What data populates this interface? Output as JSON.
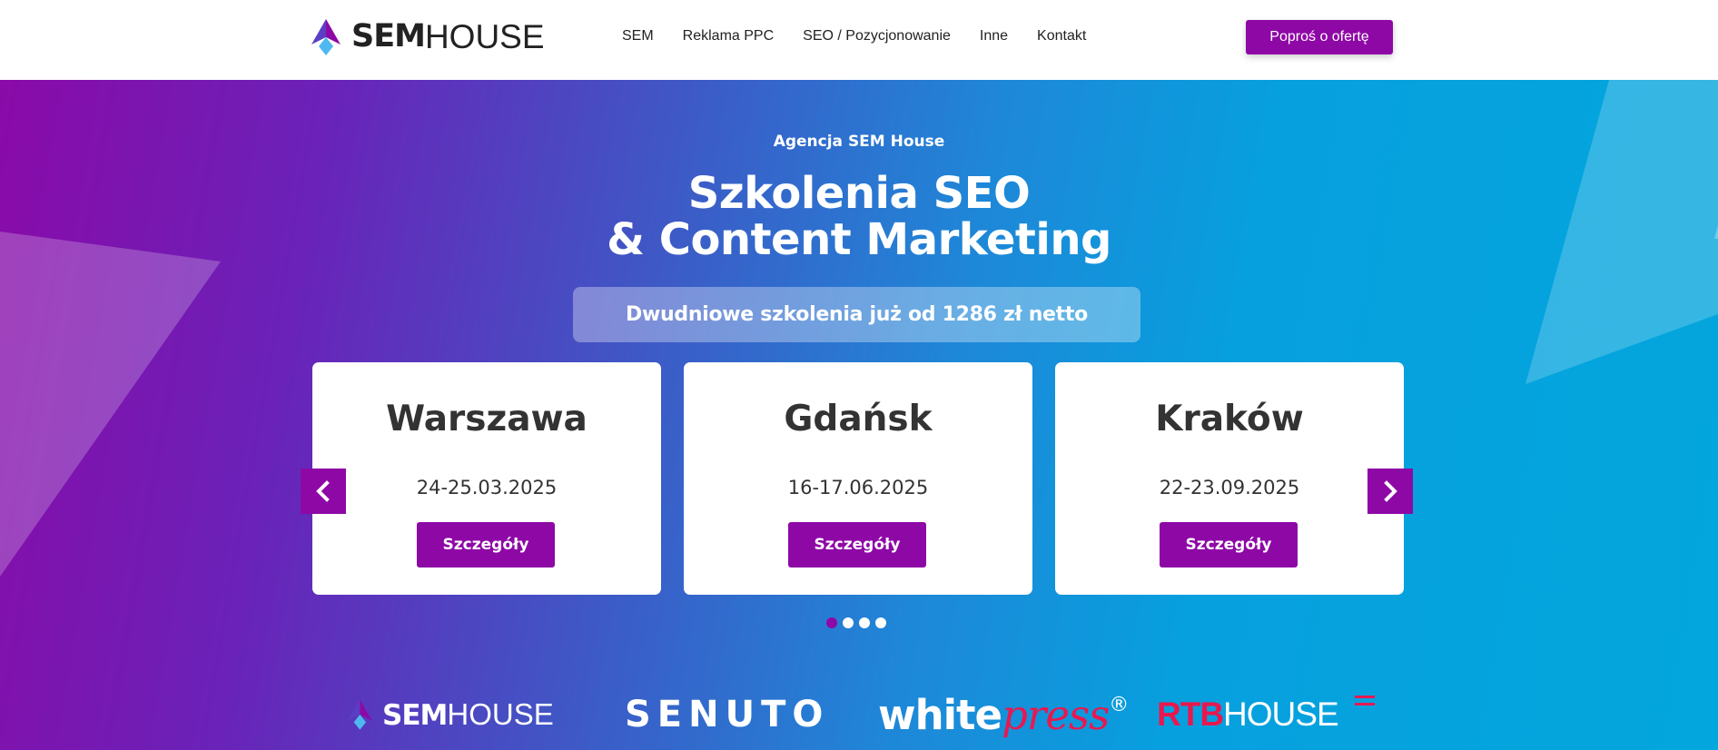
{
  "header": {
    "logo_bold": "SEM",
    "logo_light": "HOUSE",
    "nav": [
      "SEM",
      "Reklama PPC",
      "SEO / Pozycjonowanie",
      "Inne",
      "Kontakt"
    ],
    "cta_label": "Poproś o ofertę"
  },
  "hero": {
    "eyebrow": "Agencja SEM House",
    "title_line1": "Szkolenia SEO",
    "title_line2": "& Content Marketing",
    "subtitle": "Dwudniowe szkolenia już od 1286 zł netto",
    "cards": [
      {
        "city": "Warszawa",
        "date": "24-25.03.2025",
        "button": "Szczegóły"
      },
      {
        "city": "Gdańsk",
        "date": "16-17.06.2025",
        "button": "Szczegóły"
      },
      {
        "city": "Kraków",
        "date": "22-23.09.2025",
        "button": "Szczegóły"
      }
    ],
    "carousel": {
      "dot_count": 4,
      "active_index": 0
    }
  },
  "partners": {
    "semhouse_bold": "SEM",
    "semhouse_light": "HOUSE",
    "senuto": "SENUTO",
    "whitepress_white": "white",
    "whitepress_press": "press",
    "whitepress_reg": "®",
    "rtb_red": "RTB",
    "rtb_house": "HOUSE"
  },
  "colors": {
    "accent": "#8e08a6",
    "gradient_start": "#8a0aa8",
    "gradient_end": "#03a6dd",
    "partner_red": "#e8184f",
    "logo_blue": "#4a8fe0"
  },
  "icons": {
    "prev": "chevron-left-icon",
    "next": "chevron-right-icon",
    "logo": "semhouse-arrow-logo"
  }
}
